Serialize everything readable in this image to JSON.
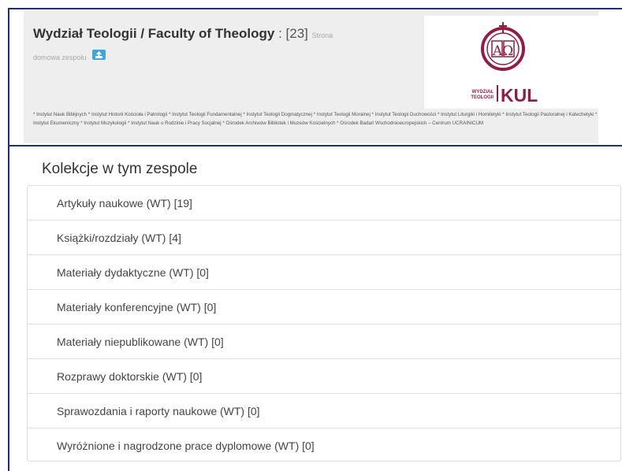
{
  "header": {
    "title": "Wydział Teologii / Faculty of Theology",
    "count_sep": " : ",
    "count": "[23]",
    "home_text_1": "Strona",
    "home_text_2": "domowa zespołu",
    "description": "* Instytut Nauk Biblijnych * Instytut Historii Kościoła i Patrologii * Instytut Teologii Fundamentalnej * Instytut Teologii Dogmatycznej * Instytut Teologii Moralnej * Instytut Teologii Duchowości * Instytut Liturgiki i Homiletyki * Instytut Teologii Pastoralnej i Katechetyki * Instytut Ekumeniczny * Instytut Muzykologii * Instytut Nauk o Rodzinie i Pracy Socjalnej * Ośrodek Archiwów Bibliotek i Muzeów Kościelnych * Ośrodek Badań Wschodnioeuropejskich – Centrum UCRAINICUM",
    "logo": {
      "emblem": "AΩ",
      "text_top": "WYDZIAŁ",
      "text_bottom": "TEOLOGII",
      "brand": "KUL",
      "color": "#8e1f43"
    }
  },
  "collections": {
    "heading": "Kolekcje w tym zespole",
    "items": [
      "Artykuły naukowe (WT) [19]",
      "Książki/rozdziały (WT) [4]",
      "Materiały dydaktyczne (WT) [0]",
      "Materiały konferencyjne (WT) [0]",
      "Materiały niepublikowane (WT) [0]",
      "Rozprawy doktorskie (WT) [0]",
      "Sprawozdania i raporty naukowe (WT) [0]",
      "Wyróżnione i nagrodzone prace dyplomowe (WT) [0]"
    ]
  },
  "colors": {
    "frame": "#1e3166",
    "header_bg": "#eeeeee",
    "home_button": "#3ea8dc",
    "logo_maroon": "#8e1f43"
  },
  "icons": {
    "home_button": "upload-icon"
  }
}
